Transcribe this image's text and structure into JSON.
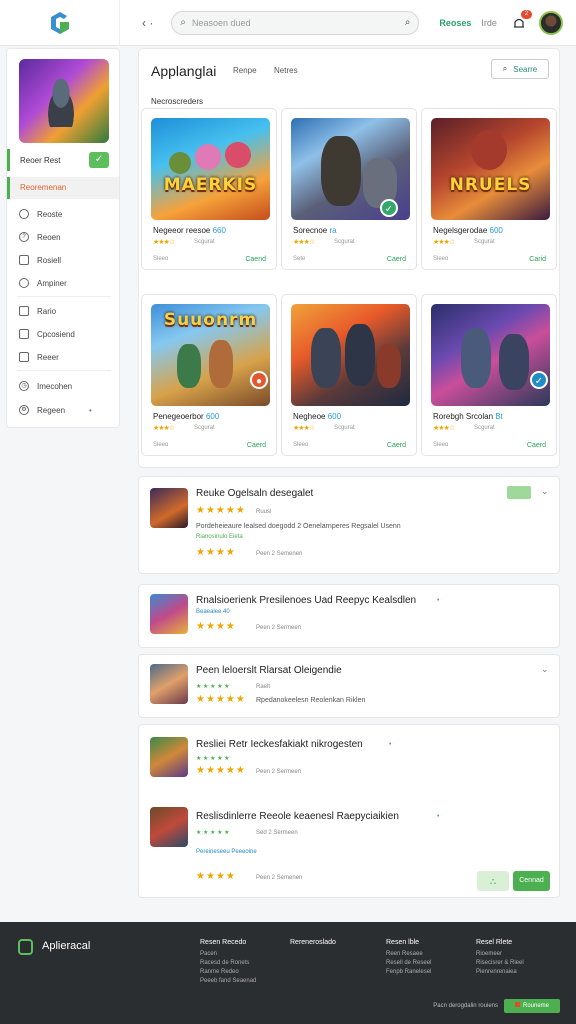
{
  "topbar": {
    "back_icon": "chevron-left",
    "search_placeholder": "Neasoen dued",
    "link_primary": "Reoses",
    "link_secondary": "Irde",
    "notification_count": "2"
  },
  "sidebar": {
    "user_name": "Reoer Rest",
    "active_item": "Reoremenan",
    "items": [
      {
        "icon": "circle-icon",
        "label": "Reoste"
      },
      {
        "icon": "help-icon",
        "label": "Reoen"
      },
      {
        "icon": "square-icon",
        "label": "Rosiell"
      },
      {
        "icon": "circle-icon",
        "label": "Ampiner"
      },
      {
        "icon": "square-icon",
        "label": "Rario"
      },
      {
        "icon": "square-icon",
        "label": "Cpcosiend"
      },
      {
        "icon": "square-icon",
        "label": "Reeer"
      },
      {
        "icon": "clock-icon",
        "label": "Imecohen"
      },
      {
        "icon": "gear-icon",
        "label": "Regeen"
      }
    ]
  },
  "main": {
    "title": "Applanglai",
    "tabs": [
      "Renpe",
      "Netres"
    ],
    "search_button": "Searre",
    "section_label": "Necroscreders",
    "cards": [
      {
        "art_text": "MAERKIS",
        "title": "Negeeor reesoe",
        "title_hl": "660",
        "rating": "Scgurat",
        "meta": "Sleeo",
        "action": "Caend",
        "badge": ""
      },
      {
        "art_text": "",
        "title": "Sorecnoe",
        "title_hl": "ra",
        "rating": "Scgurat",
        "meta": "Sete",
        "action": "Caerd",
        "badge": "check"
      },
      {
        "art_text": "NRUELS",
        "title": "Negelsgerodae",
        "title_hl": "600",
        "rating": "Scgurat",
        "meta": "Sleeo",
        "action": "Carid",
        "badge": ""
      },
      {
        "art_text": "Suuonrm",
        "title": "Penegeoerbor",
        "title_hl": "600",
        "rating": "Scgurat",
        "meta": "Sleeo",
        "action": "Caerd",
        "badge": "red"
      },
      {
        "art_text": "",
        "title": "Negheoe",
        "title_hl": "600",
        "rating": "Scgurat",
        "meta": "Sleeo",
        "action": "Caerd",
        "badge": ""
      },
      {
        "art_text": "",
        "title": "Rorebgh Srcolan",
        "title_hl": "Bt",
        "rating": "Scgurat",
        "meta": "Sleeo",
        "action": "Caerd",
        "badge": "blue"
      }
    ]
  },
  "list": [
    {
      "title": "Reuke Ogelsaln desegalet",
      "sub": "Ruusl",
      "desc": "Pordeheieaure lealsed doegodd 2 Oenelarnperes Regsalel Usenn",
      "hl": "Rianosinulo Eieta",
      "footer": "Peen 2 Semenen"
    },
    {
      "title": "Rnalsioerienk Presilenoes Uad Reepyc Kealsdlen",
      "sub": "",
      "desc": "",
      "hl": "Beaealee 40",
      "footer": "Peen 2 Sermeen"
    },
    {
      "title": "Peen leloerslt Rlarsat Oleigendie",
      "sub": "Raelt",
      "desc": "Rpedanokeelesn Reolenkan Riklen",
      "hl": "",
      "footer": ""
    },
    {
      "title": "Resliei Retr Ieckesfakiakt nikrogesten",
      "sub": "",
      "desc": "",
      "hl": "",
      "footer": "Peen 2 Sermeen"
    },
    {
      "title": "Reslisdinlerre Reeole keaenesl Raepyciaikien",
      "sub": "Sed 2 Sermeen",
      "desc": "",
      "hl": "Pereineseeu Peeeoine",
      "footer": "Peen 2 Semenen"
    }
  ],
  "list_action_label": "Cennad",
  "footer": {
    "brand": "Aplieracal",
    "columns": [
      {
        "heading": "Resen Recedo",
        "links": [
          "Pacen",
          "Racesd de Ronets",
          "Ranme Redeo",
          "Peeeb fand Seaenad"
        ]
      },
      {
        "heading": "Rereneroslado",
        "links": []
      },
      {
        "heading": "Resen lble",
        "links": [
          "Reen Resaee",
          "Resell de Reseel",
          "Fenpb Ranelesel"
        ]
      },
      {
        "heading": "Resel Rlete",
        "links": [
          "Rioemeer",
          "Risecisrer & Rleel",
          "Pienrenrenaiea"
        ]
      }
    ],
    "bottom_text": "Pacn derogdalin rouiens",
    "bottom_button": "Rouneme"
  }
}
